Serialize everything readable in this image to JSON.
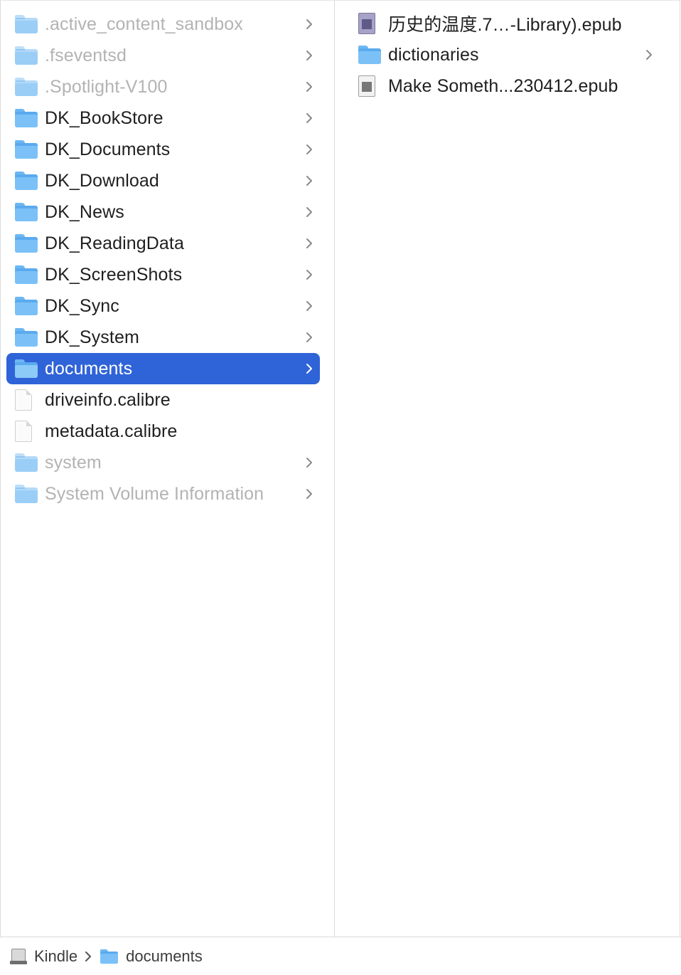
{
  "column1": {
    "items": [
      {
        "label": ".active_content_sandbox",
        "icon": "folder-icon",
        "dim": true,
        "chevron": true
      },
      {
        "label": ".fseventsd",
        "icon": "folder-icon",
        "dim": true,
        "chevron": true
      },
      {
        "label": ".Spotlight-V100",
        "icon": "folder-icon",
        "dim": true,
        "chevron": true
      },
      {
        "label": "DK_BookStore",
        "icon": "folder-icon",
        "chevron": true
      },
      {
        "label": "DK_Documents",
        "icon": "folder-icon",
        "chevron": true
      },
      {
        "label": "DK_Download",
        "icon": "folder-icon",
        "chevron": true
      },
      {
        "label": "DK_News",
        "icon": "folder-icon",
        "chevron": true
      },
      {
        "label": "DK_ReadingData",
        "icon": "folder-icon",
        "chevron": true
      },
      {
        "label": "DK_ScreenShots",
        "icon": "folder-icon",
        "chevron": true
      },
      {
        "label": "DK_Sync",
        "icon": "folder-icon",
        "chevron": true
      },
      {
        "label": "DK_System",
        "icon": "folder-icon",
        "chevron": true
      },
      {
        "label": "documents",
        "icon": "folder-icon",
        "selected": true,
        "chevron": true
      },
      {
        "label": "driveinfo.calibre",
        "icon": "document-icon"
      },
      {
        "label": "metadata.calibre",
        "icon": "document-icon"
      },
      {
        "label": "system",
        "icon": "folder-icon",
        "dim": true,
        "chevron": true
      },
      {
        "label": "System Volume Information",
        "icon": "folder-icon",
        "dim": true,
        "chevron": true
      }
    ]
  },
  "column2": {
    "items": [
      {
        "label": "历史的温度.7…-Library).epub",
        "icon": "epub-icon"
      },
      {
        "label": "dictionaries",
        "icon": "folder-icon",
        "chevron": true
      },
      {
        "label": "Make Someth...230412.epub",
        "icon": "epub-icon"
      }
    ]
  },
  "pathbar": {
    "items": [
      {
        "label": "Kindle",
        "icon": "external-disk-icon"
      },
      {
        "label": "documents",
        "icon": "folder-icon"
      }
    ]
  },
  "colors": {
    "selection": "#2f63d8",
    "folder": "#5aaaee",
    "dim_text": "#b3b3b3"
  }
}
